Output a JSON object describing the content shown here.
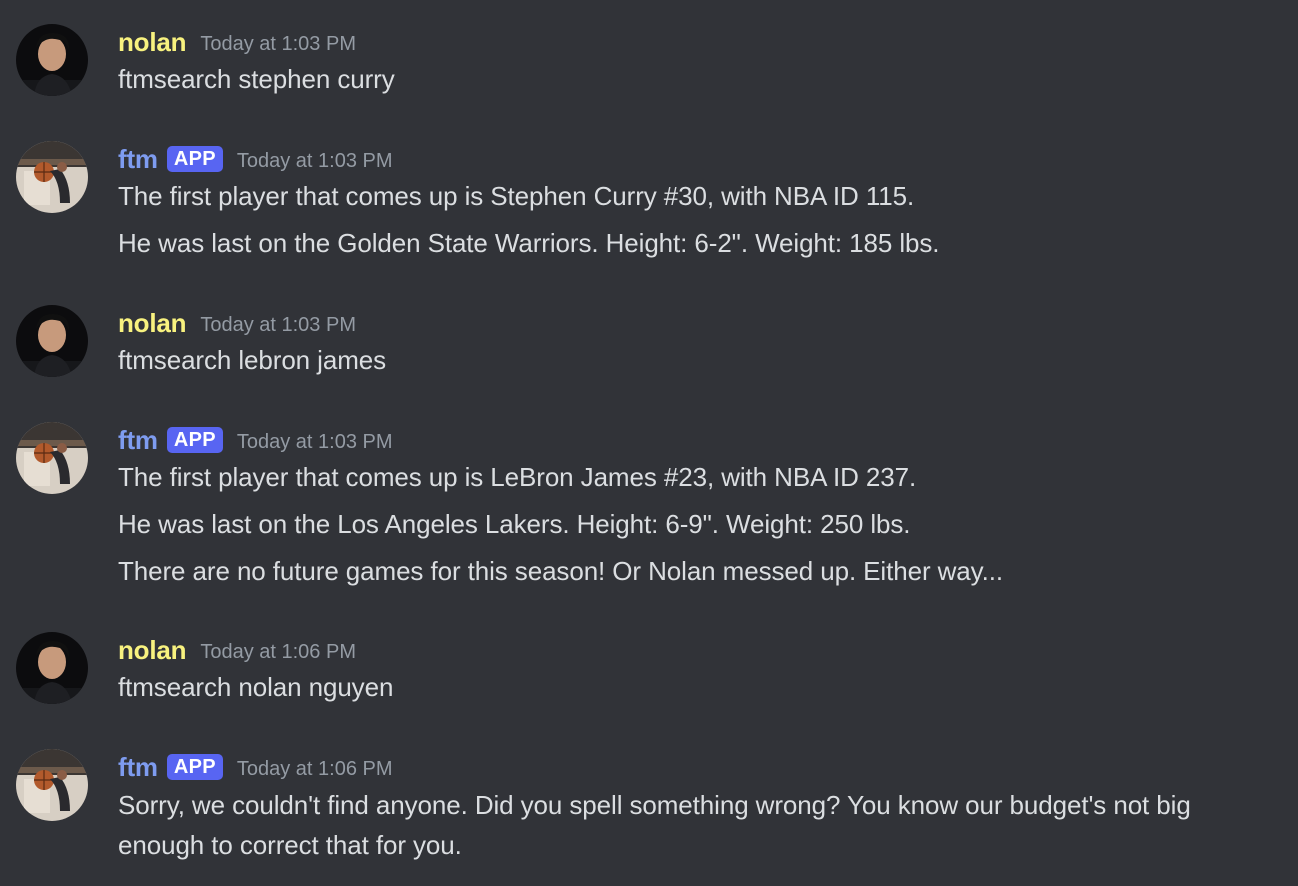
{
  "messages": [
    {
      "author": "nolan",
      "timestamp": "Today at 1:03 PM",
      "lines": [
        "ftmsearch stephen curry"
      ]
    },
    {
      "author": "ftm",
      "badge": "APP",
      "timestamp": "Today at 1:03 PM",
      "lines": [
        "The first player that comes up is Stephen Curry #30, with NBA ID 115.",
        "He was last on the Golden State Warriors. Height: 6-2\". Weight: 185 lbs."
      ]
    },
    {
      "author": "nolan",
      "timestamp": "Today at 1:03 PM",
      "lines": [
        "ftmsearch lebron james"
      ]
    },
    {
      "author": "ftm",
      "badge": "APP",
      "timestamp": "Today at 1:03 PM",
      "lines": [
        "The first player that comes up is LeBron James #23, with NBA ID 237.",
        "He was last on the Los Angeles Lakers. Height: 6-9\". Weight: 250 lbs.",
        "There are no future games for this season! Or Nolan messed up. Either way..."
      ]
    },
    {
      "author": "nolan",
      "timestamp": "Today at 1:06 PM",
      "lines": [
        "ftmsearch nolan nguyen"
      ]
    },
    {
      "author": "ftm",
      "badge": "APP",
      "timestamp": "Today at 1:06 PM",
      "lines": [
        "Sorry, we couldn't find anyone. Did you spell something wrong? You know our budget's not big enough to correct that for you."
      ]
    }
  ],
  "colors": {
    "background": "#313338",
    "nolan_name": "#f8f27f",
    "ftm_name": "#7e9cf0",
    "app_badge": "#5865f2",
    "timestamp": "#949ba4",
    "text": "#dbdee1"
  },
  "icons": {
    "nolan_avatar": "user-photo-avatar",
    "ftm_avatar": "basketball-photo-avatar"
  }
}
